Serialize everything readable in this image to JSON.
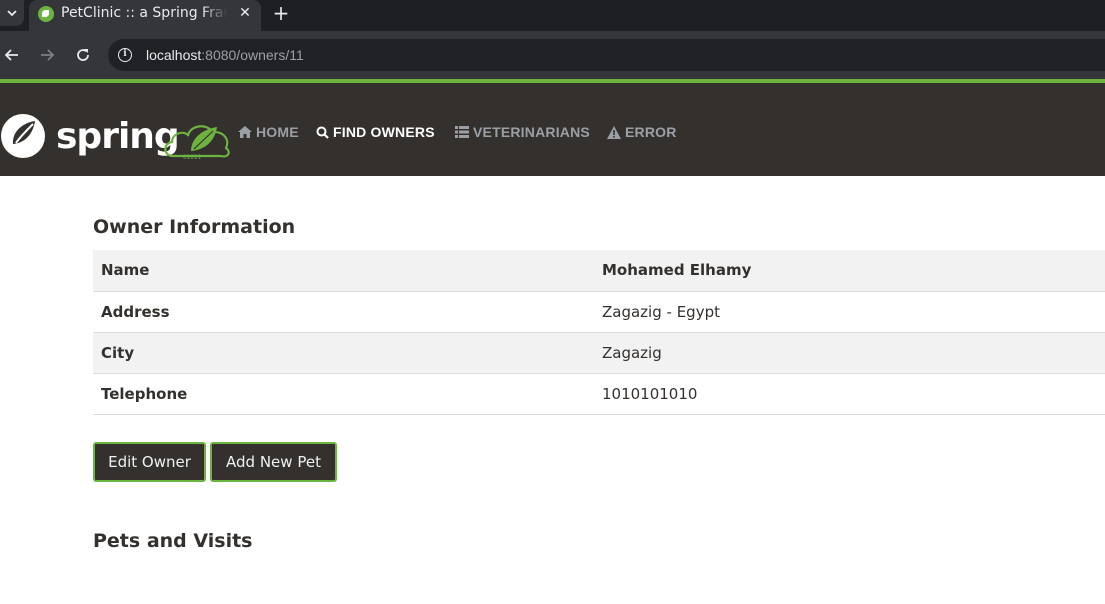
{
  "browser": {
    "tab_title": "PetClinic :: a Spring Framework demonstration",
    "close_glyph": "✕",
    "new_tab_glyph": "+",
    "url_host": "localhost",
    "url_rest": ":8080/owners/11"
  },
  "navbar": {
    "brand_text": "spring",
    "items": [
      {
        "label": "HOME",
        "icon": "home-icon"
      },
      {
        "label": "FIND OWNERS",
        "icon": "search-icon"
      },
      {
        "label": "VETERINARIANS",
        "icon": "list-icon"
      },
      {
        "label": "ERROR",
        "icon": "warning-icon"
      }
    ],
    "active_color": "#ffffff",
    "inactive_color": "#9aa0a6",
    "accent": "#6db33f"
  },
  "owner": {
    "heading": "Owner Information",
    "rows": [
      {
        "label": "Name",
        "value": "Mohamed Elhamy"
      },
      {
        "label": "Address",
        "value": "Zagazig - Egypt"
      },
      {
        "label": "City",
        "value": "Zagazig"
      },
      {
        "label": "Telephone",
        "value": "1010101010"
      }
    ]
  },
  "actions": {
    "edit_owner": "Edit Owner",
    "add_new_pet": "Add New Pet"
  },
  "pets": {
    "heading": "Pets and Visits"
  }
}
